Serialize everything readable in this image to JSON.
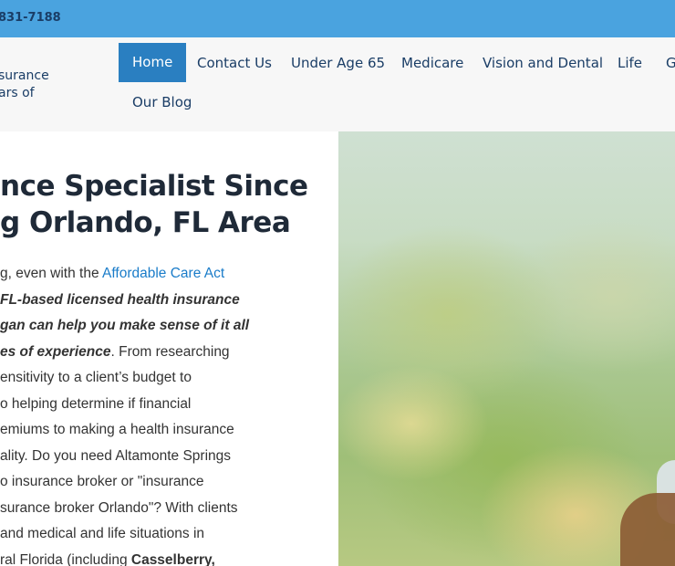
{
  "topbar": {
    "phone": "831-7188"
  },
  "header": {
    "tagline_line1": "surance",
    "tagline_line2": "ars of"
  },
  "nav": {
    "items": [
      {
        "label": "Home"
      },
      {
        "label": "Contact Us"
      },
      {
        "label": "Under Age 65"
      },
      {
        "label": "Medicare"
      },
      {
        "label": "Vision and Dental"
      },
      {
        "label": "Life"
      },
      {
        "label": "G"
      },
      {
        "label": "Our Blog"
      }
    ]
  },
  "hero": {
    "title_line1": "nce Specialist Since",
    "title_line2": "g Orlando, FL Area"
  },
  "body": {
    "l1_text": "g, even with the ",
    "l1_link": "Affordable Care Act",
    "l2_bi": "FL-based licensed health insurance",
    "l3_bi": "gan can help you make sense of it all",
    "l4_bi": "es of experience",
    "l4_text": ". From researching",
    "l5": "ensitivity to a client’s budget to",
    "l6": "o helping determine if financial",
    "l7": "emiums to making a health insurance",
    "l8": "ality. Do you need Altamonte Springs",
    "l9": "o insurance broker or \"insurance",
    "l10": "surance broker Orlando\"? With clients",
    "l11": "and medical and life situations in",
    "l12_text": "ral Florida (including ",
    "l12_bold": "Casselberry,"
  },
  "photo": {
    "description_icon": "hero-photo"
  }
}
